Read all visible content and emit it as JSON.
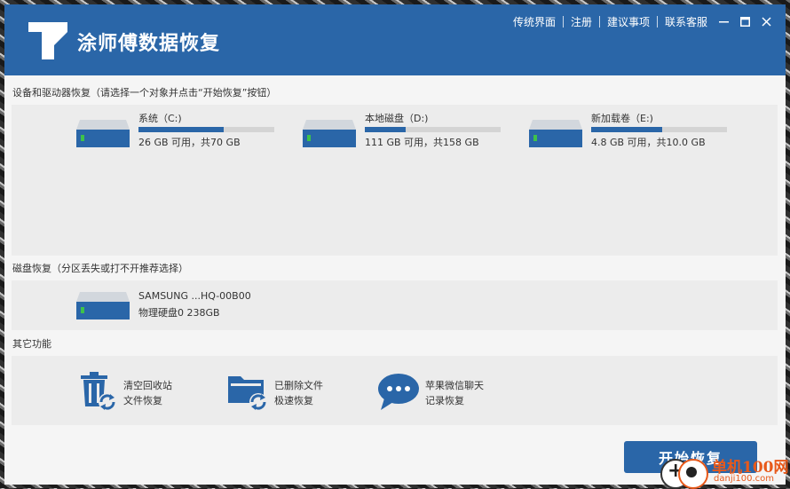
{
  "app": {
    "title": "涂师傅数据恢复"
  },
  "nav": [
    "传统界面",
    "注册",
    "建议事项",
    "联系客服"
  ],
  "sections": {
    "drives_label": "设备和驱动器恢复（请选择一个对象并点击“开始恢复”按钮）",
    "disk_label": "磁盘恢复（分区丢失或打不开推荐选择）",
    "other_label": "其它功能"
  },
  "drives": [
    {
      "name": "系统（C:)",
      "size": "26 GB 可用，共70 GB",
      "used_fraction": 0.63
    },
    {
      "name": "本地磁盘（D:)",
      "size": "111 GB 可用，共158 GB",
      "used_fraction": 0.3
    },
    {
      "name": "新加载卷（E:)",
      "size": "4.8 GB 可用，共10.0 GB",
      "used_fraction": 0.52
    }
  ],
  "disk": {
    "name": "SAMSUNG ...HQ-00B00",
    "size": "物理硬盘0 238GB"
  },
  "functions": [
    {
      "line1": "清空回收站",
      "line2": "文件恢复",
      "icon": "recycle-bin-icon"
    },
    {
      "line1": "已删除文件",
      "line2": "极速恢复",
      "icon": "folder-restore-icon"
    },
    {
      "line1": "苹果微信聊天",
      "line2": "记录恢复",
      "icon": "chat-bubble-icon"
    }
  ],
  "start_button": "开始恢复",
  "watermark": {
    "text1": "单机100网",
    "text2": "danji100.com"
  },
  "colors": {
    "primary": "#2a66a8",
    "panel": "#ececec",
    "watermark": "#e8591a"
  }
}
